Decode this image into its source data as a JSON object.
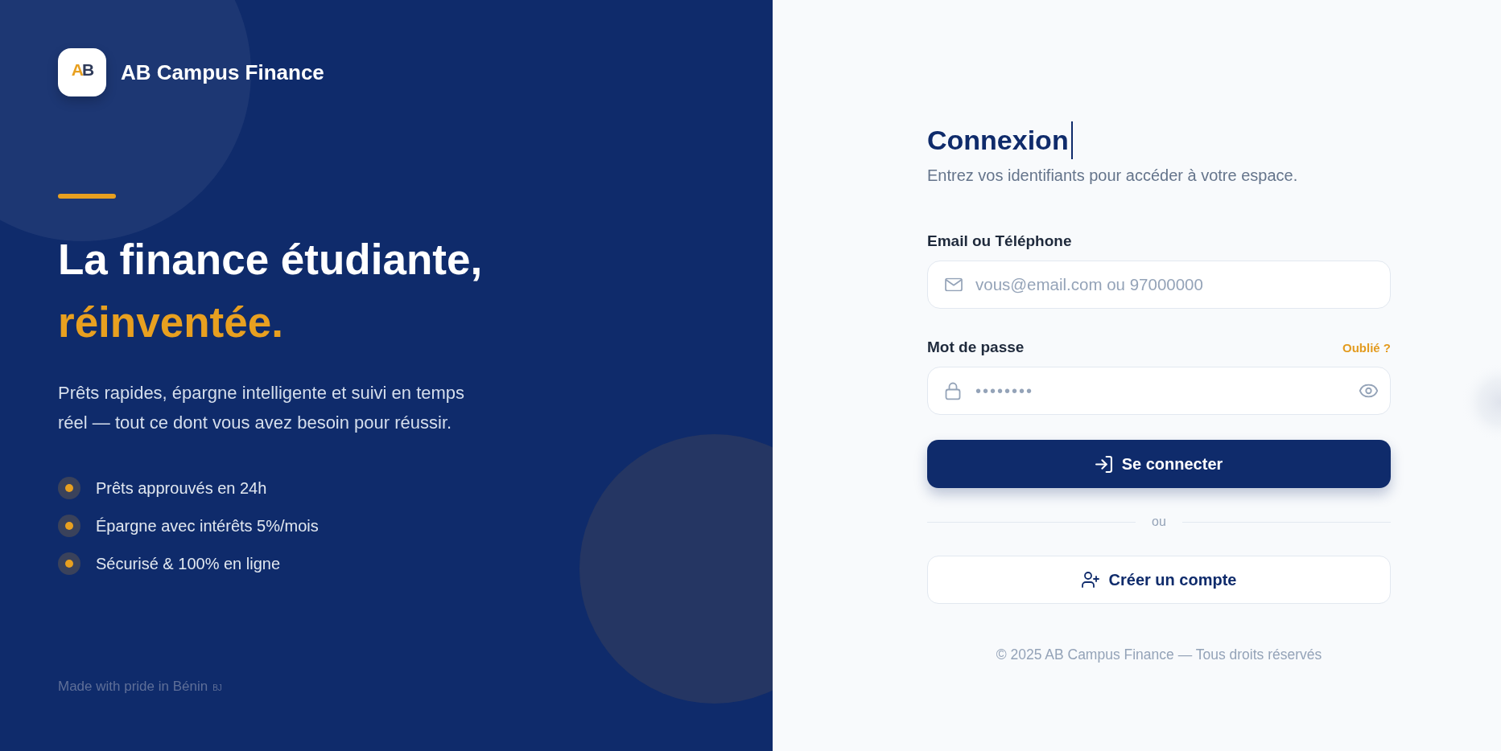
{
  "brand": {
    "logo_text": "AB",
    "name": "AB Campus Finance"
  },
  "hero": {
    "headline": "La finance étudiante,",
    "headline_accent": "réinventée.",
    "description": "Prêts rapides, épargne intelligente et suivi en temps réel — tout ce dont vous avez besoin pour réussir.",
    "features": [
      "Prêts approuvés en 24h",
      "Épargne avec intérêts 5%/mois",
      "Sécurisé & 100% en ligne"
    ],
    "footer": "Made with pride in Bénin",
    "footer_flag": "BJ"
  },
  "login": {
    "title": "Connexion",
    "title_cursor": true,
    "subtitle": "Entrez vos identifiants pour accéder à votre espace.",
    "fields": [
      {
        "kind": "email",
        "label": "Email ou Téléphone",
        "placeholder": "vous@email.com ou 97000000"
      },
      {
        "kind": "password",
        "label": "Mot de passe",
        "link": "Oublié ?",
        "placeholder": "••••••••"
      }
    ],
    "submit": "Se connecter",
    "divider": "ou",
    "signup": "Créer un compte",
    "copyright": "© 2025 AB Campus Finance — Tous droits réservés"
  }
}
